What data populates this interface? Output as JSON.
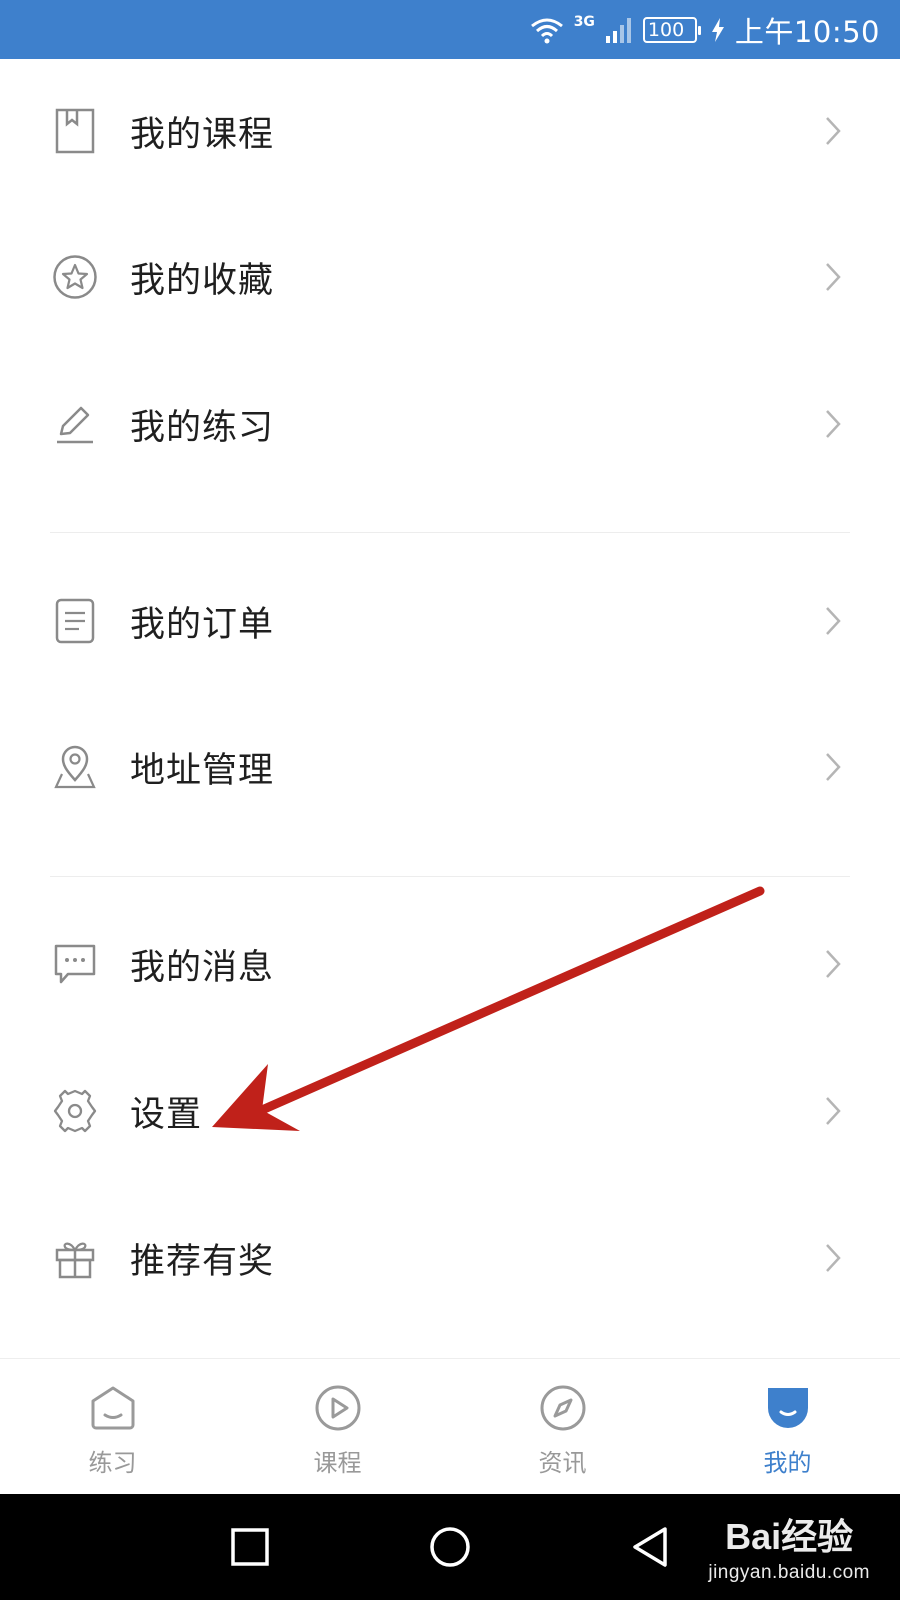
{
  "status_bar": {
    "network": "3G",
    "battery": "100",
    "time": "上午10:50"
  },
  "menu": {
    "items": [
      {
        "label": "我的课程",
        "icon": "book-icon"
      },
      {
        "label": "我的收藏",
        "icon": "star-circle-icon"
      },
      {
        "label": "我的练习",
        "icon": "pencil-icon"
      },
      {
        "label": "我的订单",
        "icon": "document-icon"
      },
      {
        "label": "地址管理",
        "icon": "location-pin-icon"
      },
      {
        "label": "我的消息",
        "icon": "message-icon"
      },
      {
        "label": "设置",
        "icon": "gear-icon"
      },
      {
        "label": "推荐有奖",
        "icon": "gift-icon"
      }
    ]
  },
  "tabbar": {
    "tabs": [
      {
        "label": "练习",
        "icon": "practice-icon",
        "active": false
      },
      {
        "label": "课程",
        "icon": "play-circle-icon",
        "active": false
      },
      {
        "label": "资讯",
        "icon": "compass-icon",
        "active": false
      },
      {
        "label": "我的",
        "icon": "profile-icon",
        "active": true
      }
    ]
  },
  "watermark": {
    "main": "Bai经验",
    "sub": "jingyan.baidu.com"
  },
  "colors": {
    "accent": "#3e80cc",
    "annotation_arrow": "#c0211a",
    "icon_gray": "#8a8a8a",
    "inactive_tab": "#999999"
  }
}
